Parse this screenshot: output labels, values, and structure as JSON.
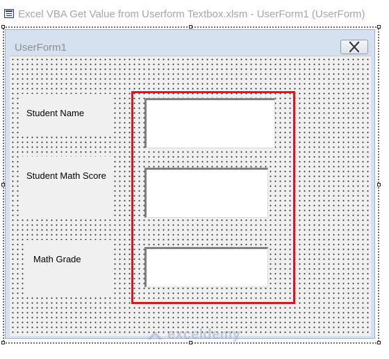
{
  "window": {
    "title": "Excel VBA Get Value from Userform Textbox.xlsm - UserForm1 (UserForm)"
  },
  "form": {
    "caption": "UserForm1",
    "close_icon": "close-x-icon"
  },
  "fields": [
    {
      "label": "Student Name",
      "value": ""
    },
    {
      "label": "Student Math Score",
      "value": ""
    },
    {
      "label": "Math Grade",
      "value": ""
    }
  ],
  "highlight_color": "#e0141c",
  "watermark": {
    "text": "exceldemy",
    "icon": "exceldemy-logo-icon"
  }
}
